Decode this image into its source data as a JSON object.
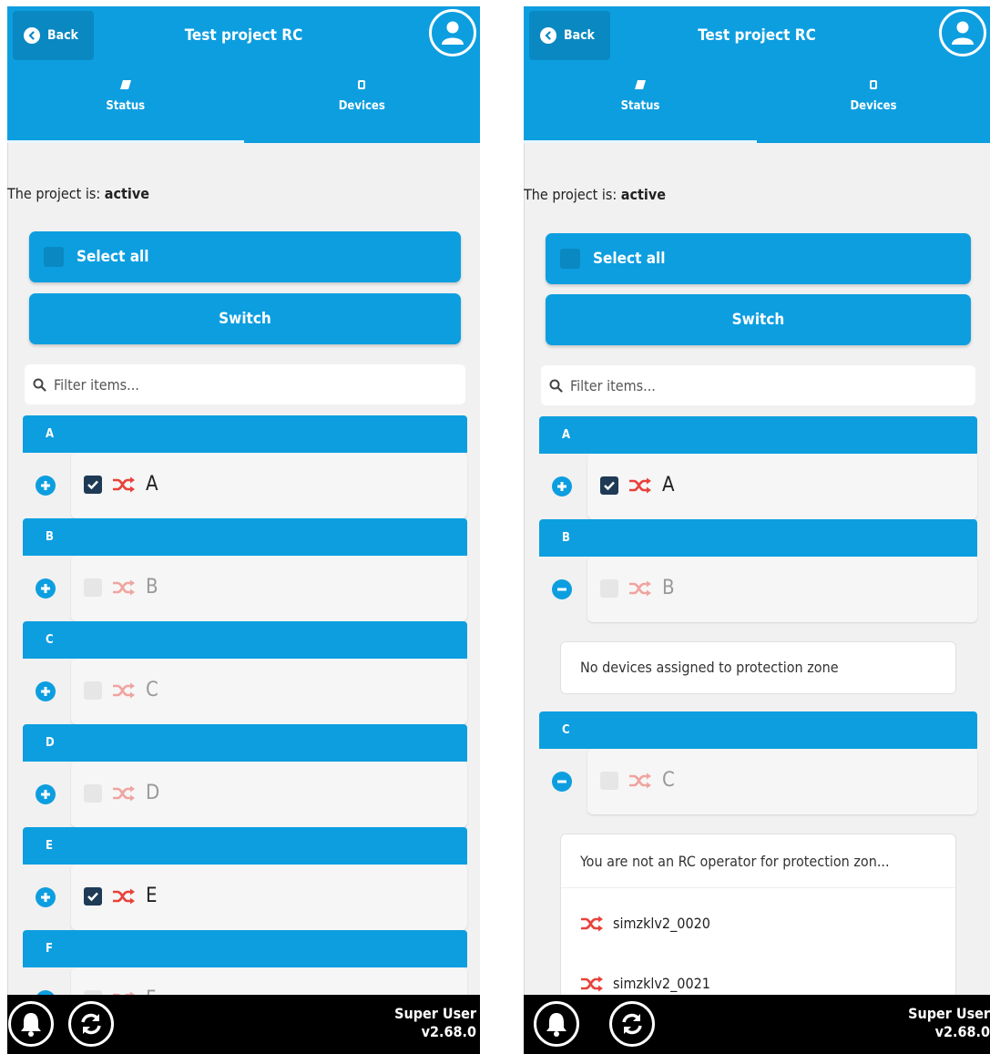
{
  "screens": [
    {
      "header": {
        "back_label": "Back",
        "title": "Test project RC"
      },
      "tabs": [
        {
          "label": "Status",
          "active": true
        },
        {
          "label": "Devices",
          "active": false
        }
      ],
      "project_state": {
        "prefix": "The project is: ",
        "value": "active"
      },
      "buttons": {
        "select_all": "Select all",
        "switch": "Switch"
      },
      "filter": {
        "placeholder": "Filter items..."
      },
      "zones": [
        {
          "header": "A",
          "name": "A",
          "checked": true,
          "enabled": true,
          "expanded": false
        },
        {
          "header": "B",
          "name": "B",
          "checked": false,
          "enabled": false,
          "expanded": false
        },
        {
          "header": "C",
          "name": "C",
          "checked": false,
          "enabled": false,
          "expanded": false
        },
        {
          "header": "D",
          "name": "D",
          "checked": false,
          "enabled": false,
          "expanded": false
        },
        {
          "header": "E",
          "name": "E",
          "checked": true,
          "enabled": true,
          "expanded": false
        },
        {
          "header": "F",
          "name": "F",
          "checked": false,
          "enabled": false,
          "expanded": false
        }
      ],
      "footer": {
        "user": "Super User",
        "version": "v2.68.0"
      }
    },
    {
      "header": {
        "back_label": "Back",
        "title": "Test project RC"
      },
      "tabs": [
        {
          "label": "Status",
          "active": true
        },
        {
          "label": "Devices",
          "active": false
        }
      ],
      "project_state": {
        "prefix": "The project is: ",
        "value": "active"
      },
      "buttons": {
        "select_all": "Select all",
        "switch": "Switch"
      },
      "filter": {
        "placeholder": "Filter items..."
      },
      "zones": [
        {
          "header": "A",
          "name": "A",
          "checked": true,
          "enabled": true,
          "expanded": false
        },
        {
          "header": "B",
          "name": "B",
          "checked": false,
          "enabled": false,
          "expanded": true,
          "message": "No devices assigned to protection zone"
        },
        {
          "header": "C",
          "name": "C",
          "checked": false,
          "enabled": false,
          "expanded": true,
          "message": "You are not an RC operator for protection zon...",
          "devices": [
            "simzklv2_0020",
            "simzklv2_0021"
          ]
        }
      ],
      "footer": {
        "user": "Super User",
        "version": "v2.68.0"
      }
    }
  ],
  "colors": {
    "primary": "#0d9ee0",
    "primary_dark": "#0a88c2",
    "shuffle_red": "#e8423a",
    "checkbox_dark": "#1f3a55",
    "background": "#f1f1f1"
  },
  "icons": [
    "chevron-left-icon",
    "user-icon",
    "tag-icon",
    "device-icon",
    "search-icon",
    "plus-circle-icon",
    "minus-circle-icon",
    "checkbox-icon",
    "shuffle-icon",
    "bell-icon",
    "refresh-icon"
  ]
}
